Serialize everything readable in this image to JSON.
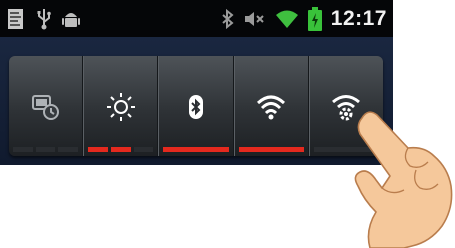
{
  "status_bar": {
    "time": "12:17",
    "left_icons": [
      "notes-icon",
      "usb-icon",
      "android-debug-icon"
    ],
    "right_icons": [
      "bluetooth-icon",
      "volume-muted-icon",
      "wifi-icon",
      "battery-charging-icon"
    ],
    "wifi_color": "#3fbf3f",
    "battery_color": "#39c23a"
  },
  "power_widget": {
    "toggles": [
      {
        "name": "screen-timeout",
        "icon": "screen-timeout-icon",
        "indicator": [
          false,
          false,
          false
        ]
      },
      {
        "name": "brightness",
        "icon": "brightness-icon",
        "indicator": [
          true,
          true,
          false
        ]
      },
      {
        "name": "bluetooth",
        "icon": "bluetooth-icon",
        "indicator": [
          true
        ]
      },
      {
        "name": "wifi",
        "icon": "wifi-icon",
        "indicator": [
          true
        ]
      },
      {
        "name": "wifi-settings",
        "icon": "wifi-settings-icon",
        "indicator": [
          false
        ]
      }
    ],
    "active_color": "#e4291e"
  }
}
